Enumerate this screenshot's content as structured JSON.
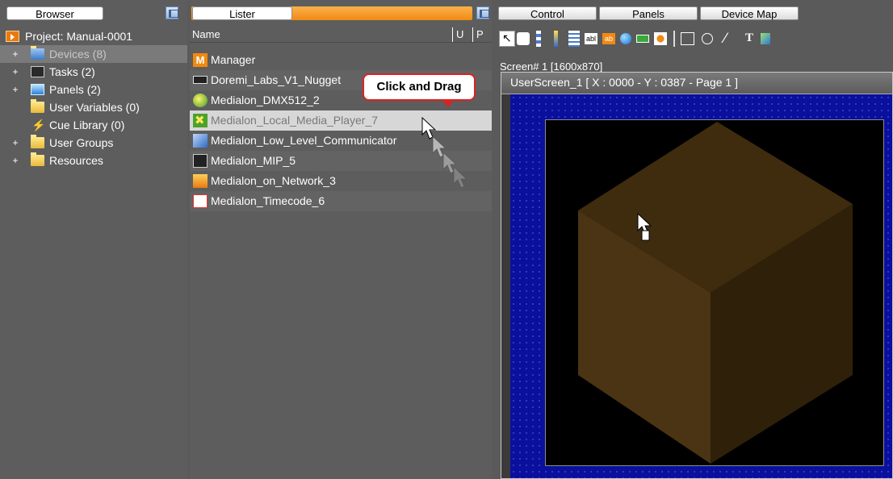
{
  "browser": {
    "tab_label": "Browser",
    "tree": [
      {
        "label": "Project: Manual-0001",
        "icon": "project-icon",
        "expander": ""
      },
      {
        "label": "Devices (8)",
        "icon": "devices-folder-icon",
        "expander": "+"
      },
      {
        "label": "Tasks (2)",
        "icon": "tasks-icon",
        "expander": "+"
      },
      {
        "label": "Panels (2)",
        "icon": "panels-icon",
        "expander": "+"
      },
      {
        "label": "User Variables (0)",
        "icon": "folder-icon",
        "expander": ""
      },
      {
        "label": "Cue Library (0)",
        "icon": "cue-library-icon",
        "expander": ""
      },
      {
        "label": "User Groups",
        "icon": "folder-icon",
        "expander": "+"
      },
      {
        "label": "Resources",
        "icon": "folder-icon",
        "expander": "+"
      }
    ]
  },
  "lister": {
    "tab_label": "Lister",
    "columns": {
      "name": "Name",
      "u": "U",
      "p": "P"
    },
    "items": [
      {
        "label": "Manager",
        "icon": "manager-icon"
      },
      {
        "label": "Doremi_Labs_V1_Nugget",
        "icon": "doremi-device-icon"
      },
      {
        "label": "Medialon_DMX512_2",
        "icon": "dmx-device-icon"
      },
      {
        "label": "Medialon_Local_Media_Player_7",
        "icon": "media-player-icon"
      },
      {
        "label": "Medialon_Low_Level_Communicator",
        "icon": "communicator-icon"
      },
      {
        "label": "Medialon_MIP_5",
        "icon": "mip-icon"
      },
      {
        "label": "Medialon_on_Network_3",
        "icon": "network-icon"
      },
      {
        "label": "Medialon_Timecode_6",
        "icon": "timecode-icon"
      }
    ],
    "tooltip": "Click and Drag"
  },
  "control": {
    "tabs": [
      "Control",
      "Panels",
      "Device Map"
    ],
    "screen_label": "Screen# 1 [1600x870]",
    "window_title": "UserScreen_1 [ X : 0000 - Y : 0387 - Page 1 ]"
  },
  "colors": {
    "accent_orange": "#f08a14",
    "canvas_blue": "#0a109c",
    "cube_top": "#3f2c0f",
    "cube_left": "#4a3414",
    "cube_right": "#2f2109"
  }
}
